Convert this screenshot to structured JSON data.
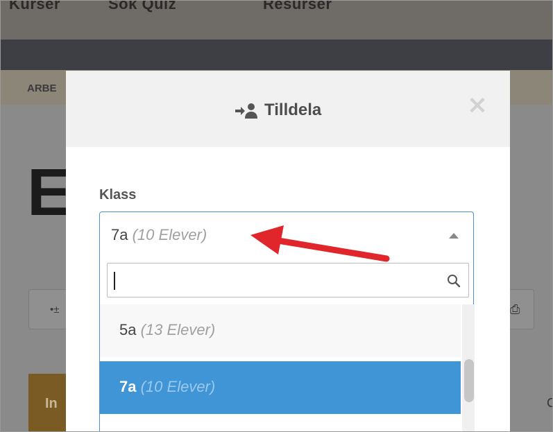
{
  "background": {
    "nav_items": [
      "Kurser",
      "Sök Quiz",
      "Resurser"
    ],
    "breadcrumb": "ARBE",
    "page_letter": "E",
    "left_button_text": "•±",
    "gold_button_text": "In",
    "right_edge_char": "C"
  },
  "modal": {
    "title": "Tilldela",
    "title_icon": "assign-user-icon",
    "close_icon": "close-icon",
    "field_label": "Klass",
    "selected": {
      "name": "7a",
      "hint": "(10 Elever)"
    },
    "search": {
      "value": "",
      "placeholder": "",
      "icon": "search-icon"
    },
    "options": [
      {
        "name": "5a",
        "hint": "(13 Elever)"
      },
      {
        "name": "7a",
        "hint": "(10 Elever)",
        "selected": true
      }
    ]
  },
  "colors": {
    "accent": "#3f95d6",
    "select_border": "#4a90d9",
    "annotation_arrow": "#e0262a"
  }
}
